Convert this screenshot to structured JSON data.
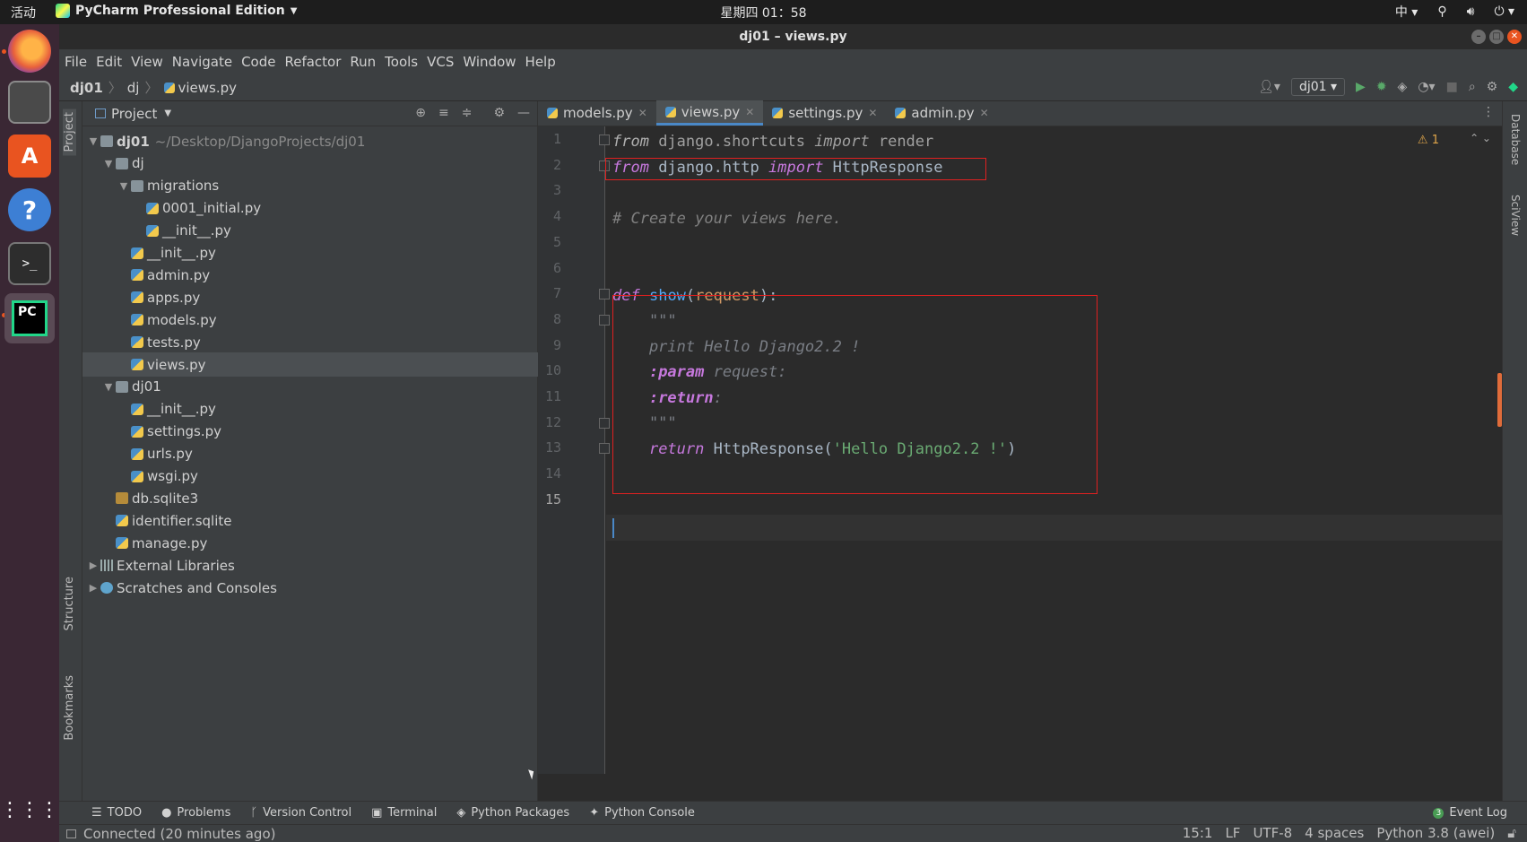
{
  "topbar": {
    "activities": "活动",
    "app_name": "PyCharm Professional Edition",
    "clock": "星期四 01：58",
    "input_method": "中"
  },
  "window": {
    "title": "dj01 – views.py"
  },
  "menu": [
    "File",
    "Edit",
    "View",
    "Navigate",
    "Code",
    "Refactor",
    "Run",
    "Tools",
    "VCS",
    "Window",
    "Help"
  ],
  "breadcrumb": [
    "dj01",
    "dj",
    "views.py"
  ],
  "run_config": "dj01",
  "project_panel": {
    "title": "Project",
    "tree": [
      {
        "label": "dj01",
        "muted": "~/Desktop/DjangoProjects/dj01",
        "type": "folder",
        "depth": 0,
        "open": true,
        "bold": true
      },
      {
        "label": "dj",
        "type": "folder",
        "depth": 1,
        "open": true
      },
      {
        "label": "migrations",
        "type": "folder",
        "depth": 2,
        "open": true
      },
      {
        "label": "0001_initial.py",
        "type": "py",
        "depth": 3
      },
      {
        "label": "__init__.py",
        "type": "py",
        "depth": 3
      },
      {
        "label": "__init__.py",
        "type": "py",
        "depth": 2
      },
      {
        "label": "admin.py",
        "type": "py",
        "depth": 2
      },
      {
        "label": "apps.py",
        "type": "py",
        "depth": 2
      },
      {
        "label": "models.py",
        "type": "py",
        "depth": 2
      },
      {
        "label": "tests.py",
        "type": "py",
        "depth": 2
      },
      {
        "label": "views.py",
        "type": "py",
        "depth": 2,
        "selected": true
      },
      {
        "label": "dj01",
        "type": "folder",
        "depth": 1,
        "open": true
      },
      {
        "label": "__init__.py",
        "type": "py",
        "depth": 2
      },
      {
        "label": "settings.py",
        "type": "py",
        "depth": 2
      },
      {
        "label": "urls.py",
        "type": "py",
        "depth": 2
      },
      {
        "label": "wsgi.py",
        "type": "py",
        "depth": 2
      },
      {
        "label": "db.sqlite3",
        "type": "db",
        "depth": 1
      },
      {
        "label": "identifier.sqlite",
        "type": "py",
        "depth": 1
      },
      {
        "label": "manage.py",
        "type": "py",
        "depth": 1
      },
      {
        "label": "External Libraries",
        "type": "lib",
        "depth": 0,
        "collapsed": true
      },
      {
        "label": "Scratches and Consoles",
        "type": "scratch",
        "depth": 0,
        "collapsed": true
      }
    ]
  },
  "left_stripe": [
    "Project",
    "Structure",
    "Bookmarks"
  ],
  "right_stripe": [
    "Database",
    "SciView"
  ],
  "tabs": [
    {
      "label": "models.py",
      "active": false
    },
    {
      "label": "views.py",
      "active": true
    },
    {
      "label": "settings.py",
      "active": false
    },
    {
      "label": "admin.py",
      "active": false
    }
  ],
  "editor": {
    "warning_count": "1",
    "line_numbers": [
      "1",
      "2",
      "3",
      "4",
      "5",
      "6",
      "7",
      "8",
      "9",
      "10",
      "11",
      "12",
      "13",
      "14",
      "15"
    ],
    "code": {
      "l1": {
        "a": "from",
        " b": " django.shortcuts ",
        "c": "import",
        "d": " render"
      },
      "l2": {
        "a": "from",
        "b": " django.http ",
        "c": "import",
        "d": " HttpResponse"
      },
      "l4": "# Create your views here.",
      "l7": {
        "a": "def",
        "b": " ",
        "c": "show",
        "d": "(",
        "e": "request",
        "f": "):"
      },
      "l8": "    \"\"\"",
      "l9": "    print Hello Django2.2 !",
      "l10": {
        "a": "    ",
        "b": ":param",
        "c": " request:"
      },
      "l11": {
        "a": "    ",
        "b": ":return",
        "c": ":"
      },
      "l12": "    \"\"\"",
      "l13": {
        "a": "    ",
        "b": "return",
        "c": " HttpResponse(",
        "d": "'Hello Django2.2 !'",
        "e": ")"
      }
    }
  },
  "bottom_tools": [
    "TODO",
    "Problems",
    "Version Control",
    "Terminal",
    "Python Packages",
    "Python Console"
  ],
  "event_log": "Event Log",
  "status": {
    "message": "Connected (20 minutes ago)",
    "position": "15:1",
    "line_sep": "LF",
    "encoding": "UTF-8",
    "indent": "4 spaces",
    "interpreter": "Python 3.8 (awei)"
  }
}
